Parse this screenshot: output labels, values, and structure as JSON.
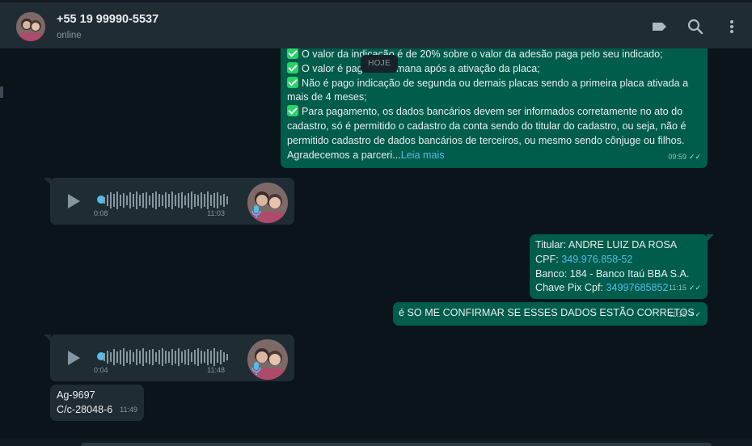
{
  "contact": {
    "name": "+55 19 99990-5537",
    "status": "online"
  },
  "header_icons": [
    "label-icon",
    "search-icon",
    "menu-icon"
  ],
  "date_divider": "HOJE",
  "messages": {
    "m1": {
      "lines": [
        "O valor da indicação é de 20% sobre o valor da adesão paga pelo seu indicado;",
        "O valor é pago na semana após a ativação da placa;",
        "Não é pago indicação de segunda ou demais placas sendo a primeira placa ativada a",
        "mais de 4 meses;",
        "Para pagamento, os dados bancários devem ser informados corretamente no ato do",
        "cadastro, só é permitido o cadastro da conta sendo do titular do cadastro, ou seja, não é",
        "permitido cadastro de dados bancários de terceiros, ou mesmo sendo cônjuge ou filhos.",
        "Agradecemos a parceri..."
      ],
      "read_more": "Leia mais",
      "time": "09:59"
    },
    "voice1": {
      "duration": "0:08",
      "time": "11:03"
    },
    "m2": {
      "l1": "Titular: ANDRE LUIZ DA ROSA",
      "l2_label": "CPF: ",
      "l2_link": "349.976.858-52",
      "l3": "Banco: 184 - Banco Itaú BBA S.A.",
      "l4_label": "Chave Pix Cpf: ",
      "l4_link": "34997685852",
      "time": "11:15"
    },
    "m3": {
      "text": "é SO ME CONFIRMAR SE ESSES DADOS ESTÃO CORRETOS",
      "time": "11:15"
    },
    "voice2": {
      "duration": "0:04",
      "time": "11:48"
    },
    "m4": {
      "l1": "Ag-9697",
      "l2": "C/c-28048-6",
      "time": "11:49"
    }
  },
  "colors": {
    "outgoing": "#005c4b",
    "incoming": "#202c33",
    "link": "#53bdeb",
    "header": "#202c33"
  }
}
